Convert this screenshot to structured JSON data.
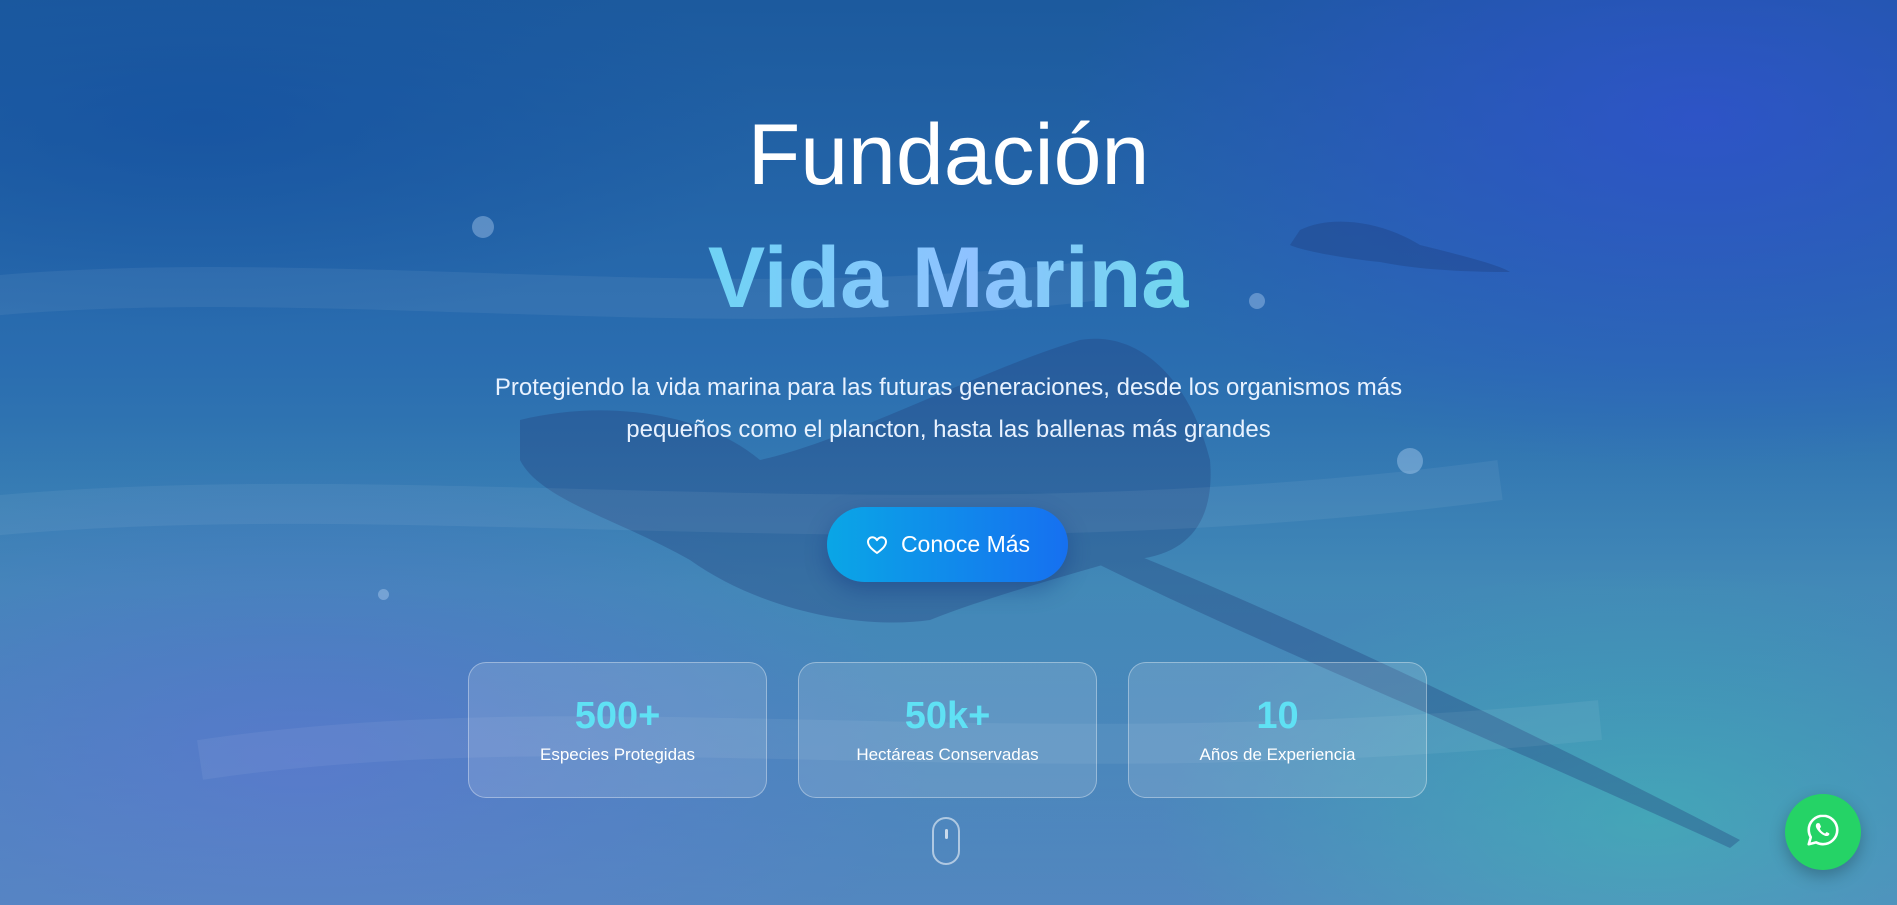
{
  "hero": {
    "title_line1": "Fundación",
    "title_line2": "Vida Marina",
    "subtitle_line1": "Protegiendo la vida marina para las futuras generaciones, desde los organismos más",
    "subtitle_line2": "pequeños como el plancton, hasta las ballenas más grandes",
    "cta_label": "Conoce Más",
    "cta_icon": "heart-icon"
  },
  "stats": [
    {
      "value": "500+",
      "label": "Especies Protegidas"
    },
    {
      "value": "50k+",
      "label": "Hectáreas Conservadas"
    },
    {
      "value": "10",
      "label": "Años de Experiencia"
    }
  ],
  "floating": {
    "whatsapp_icon": "whatsapp-icon",
    "scroll_indicator_icon": "mouse-scroll-icon"
  },
  "colors": {
    "accent_cyan": "#5fe1f4",
    "cta_start": "#0aa6e6",
    "cta_end": "#1670f0",
    "whatsapp_green": "#25d366"
  }
}
